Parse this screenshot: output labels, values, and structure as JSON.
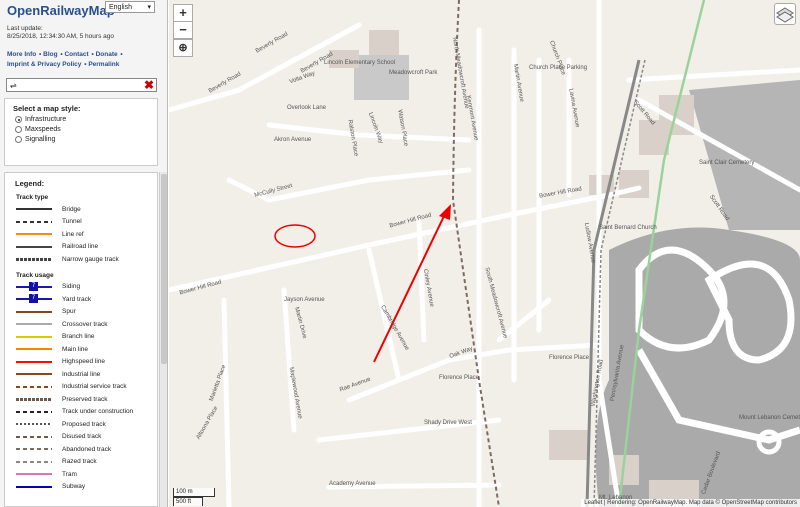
{
  "sidebar": {
    "title": "OpenRailwayMap",
    "language": "English",
    "last_update_label": "Last update:",
    "last_update_value": "8/25/2018, 12:34:30 AM, 5 hours ago",
    "links": [
      "More Info",
      "Blog",
      "Contact",
      "Donate",
      "Imprint & Privacy Policy",
      "Permalink"
    ],
    "search": {
      "value": "⇌"
    },
    "map_style": {
      "heading": "Select a map style:",
      "options": [
        "Infrastructure",
        "Maxspeeds",
        "Signalling"
      ],
      "selected": "Infrastructure"
    },
    "legend": {
      "heading": "Legend:",
      "track_type_heading": "Track type",
      "track_type": [
        {
          "label": "Bridge",
          "color": "#333333",
          "style": "solid"
        },
        {
          "label": "Tunnel",
          "color": "#333333",
          "style": "dash"
        },
        {
          "label": "Line ref",
          "color": "#f58a1f",
          "style": "solid"
        },
        {
          "label": "Railroad line",
          "color": "#444444",
          "style": "solid"
        },
        {
          "label": "Narrow gauge track",
          "color": "#444444",
          "style": "tick"
        }
      ],
      "track_usage_heading": "Track usage",
      "track_usage": [
        {
          "label": "Siding",
          "color": "#1a1aaa",
          "style": "sq"
        },
        {
          "label": "Yard track",
          "color": "#1a1aaa",
          "style": "sq"
        },
        {
          "label": "Spur",
          "color": "#87491d",
          "style": "solid"
        },
        {
          "label": "Crossover track",
          "color": "#aaaaaa",
          "style": "solid"
        },
        {
          "label": "Branch line",
          "color": "#daca00",
          "style": "solid"
        },
        {
          "label": "Main line",
          "color": "#ff8100",
          "style": "solid"
        },
        {
          "label": "Highspeed line",
          "color": "#ff0c00",
          "style": "solid"
        },
        {
          "label": "Industrial line",
          "color": "#87491d",
          "style": "solid"
        },
        {
          "label": "Industrial service track",
          "color": "#87491d",
          "style": "dash"
        },
        {
          "label": "Preserved track",
          "color": "#70584d",
          "style": "tick"
        },
        {
          "label": "Track under construction",
          "color": "#222222",
          "style": "dash"
        },
        {
          "label": "Proposed track",
          "color": "#555555",
          "style": "dot"
        },
        {
          "label": "Disused track",
          "color": "#70584d",
          "style": "dash"
        },
        {
          "label": "Abandoned track",
          "color": "#7f6a62",
          "style": "dash"
        },
        {
          "label": "Razed track",
          "color": "#94847f",
          "style": "dash"
        },
        {
          "label": "Tram",
          "color": "#d877b8",
          "style": "solid"
        },
        {
          "label": "Subway",
          "color": "#0300c3",
          "style": "solid"
        }
      ]
    }
  },
  "map": {
    "zoom_in": "+",
    "zoom_out": "−",
    "locate": "⊕",
    "scale_m": "100 m",
    "scale_ft": "500 ft",
    "attribution": "Leaflet | Rendering: OpenRailwayMap. Map data © OpenStreetMap contributors",
    "labels": [
      "Beverly Road",
      "Beverly Road",
      "Beverly Road",
      "Volta Way",
      "Overlook Lane",
      "Akron Avenue",
      "McCully Street",
      "Bower Hill Road",
      "Bower Hill Road",
      "Bower Hill Road",
      "Jayson Avenue",
      "Martin Drive",
      "Rae Avenue",
      "Shady Drive West",
      "Academy Avenue",
      "Florence Place",
      "Florence Place",
      "Oak Way",
      "Cedar Boulevard",
      "South Meadowcroft Avenue",
      "Cinley Avenue",
      "North Meadowcroft Avenue",
      "Kenmont Avenue",
      "Martin Avenue",
      "Church Place",
      "Lavina Avenue",
      "Scott Road",
      "Scott Road",
      "Saint Clair Cemetery",
      "Saint Bernard Church",
      "Mount Lebanon Cemetery",
      "Meadowcroft Park",
      "Lincoln Elementary School",
      "Washington Road",
      "Mt. Lebanon",
      "Watson Place",
      "Lincoln Way",
      "Ralston Place",
      "Pennsylvania Avenue",
      "Altoona Place",
      "Marietta Place",
      "Maplewood Avenue",
      "Cambridge Avenue",
      "Ludlow Avenue",
      "Church Place Parking"
    ]
  }
}
